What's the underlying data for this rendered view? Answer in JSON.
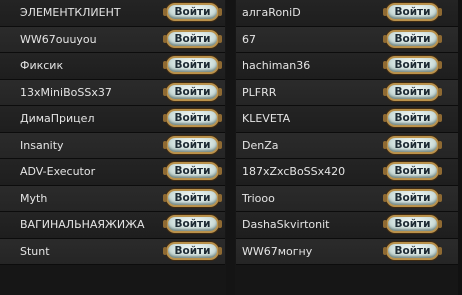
{
  "left_players": [
    {
      "name": "ЭЛЕМЕНТКЛИЕНТ",
      "button": "Войти"
    },
    {
      "name": "WW67ouuyou",
      "button": "Войти"
    },
    {
      "name": "Фиксик",
      "button": "Войти"
    },
    {
      "name": "13xMiniBoSSx37",
      "button": "Войти"
    },
    {
      "name": "ДимаПрицел",
      "button": "Войти"
    },
    {
      "name": "Insanity",
      "button": "Войти"
    },
    {
      "name": "ADV-Executor",
      "button": "Войти"
    },
    {
      "name": "Myth",
      "button": "Войти"
    },
    {
      "name": "ВАГИНАЛЬНАЯЖИЖА",
      "button": "Войти"
    },
    {
      "name": "Stunt",
      "button": "Войти"
    }
  ],
  "right_players": [
    {
      "name": "алгаRoniD",
      "button": "Войти"
    },
    {
      "name": "67",
      "button": "Войти"
    },
    {
      "name": "hachiman36",
      "button": "Войти"
    },
    {
      "name": "PLFRR",
      "button": "Войти"
    },
    {
      "name": "KLEVETA",
      "button": "Войти"
    },
    {
      "name": "DenZa",
      "button": "Войти"
    },
    {
      "name": "187xZxcBoSSx420",
      "button": "Войти"
    },
    {
      "name": "Triooo",
      "button": "Войти"
    },
    {
      "name": "DashaSkvirtonit",
      "button": "Войти"
    },
    {
      "name": "WW67могну",
      "button": "Войти"
    }
  ]
}
